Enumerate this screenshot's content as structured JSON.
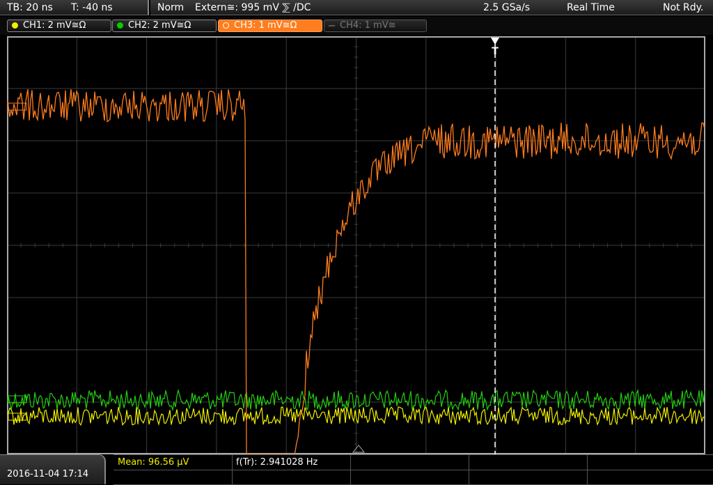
{
  "header": {
    "timebase": "TB: 20 ns",
    "trigger_time": "T: -40 ns",
    "mode": "Norm",
    "trigger_source": "Extern≅: 995 mV ⅀ /DC",
    "sample_rate": "2.5 GSa/s",
    "acq_mode": "Real Time",
    "status": "Not Rdy."
  },
  "channels": [
    {
      "label": "CH1: 2 mV≅Ω",
      "color": "#f0f000",
      "state": "on"
    },
    {
      "label": "CH2: 2 mV≅Ω",
      "color": "#00d000",
      "state": "on"
    },
    {
      "label": "CH3: 1 mV≅Ω",
      "color": "#ff7d1e",
      "state": "active"
    },
    {
      "label": "CH4: 1 mV≅",
      "color": "#555555",
      "state": "off"
    }
  ],
  "trigger_marker": "T",
  "timestamp": "2016-11-04  17:14",
  "measurements": {
    "mean": "Mean: 96.56 µV",
    "freq": "f(Tr): 2.941028 Hz"
  },
  "colors": {
    "ch1": "#f0f000",
    "ch2": "#22d010",
    "ch3": "#ff7d1e",
    "grid": "#3c3c3c",
    "border": "#aaaaaa"
  }
}
